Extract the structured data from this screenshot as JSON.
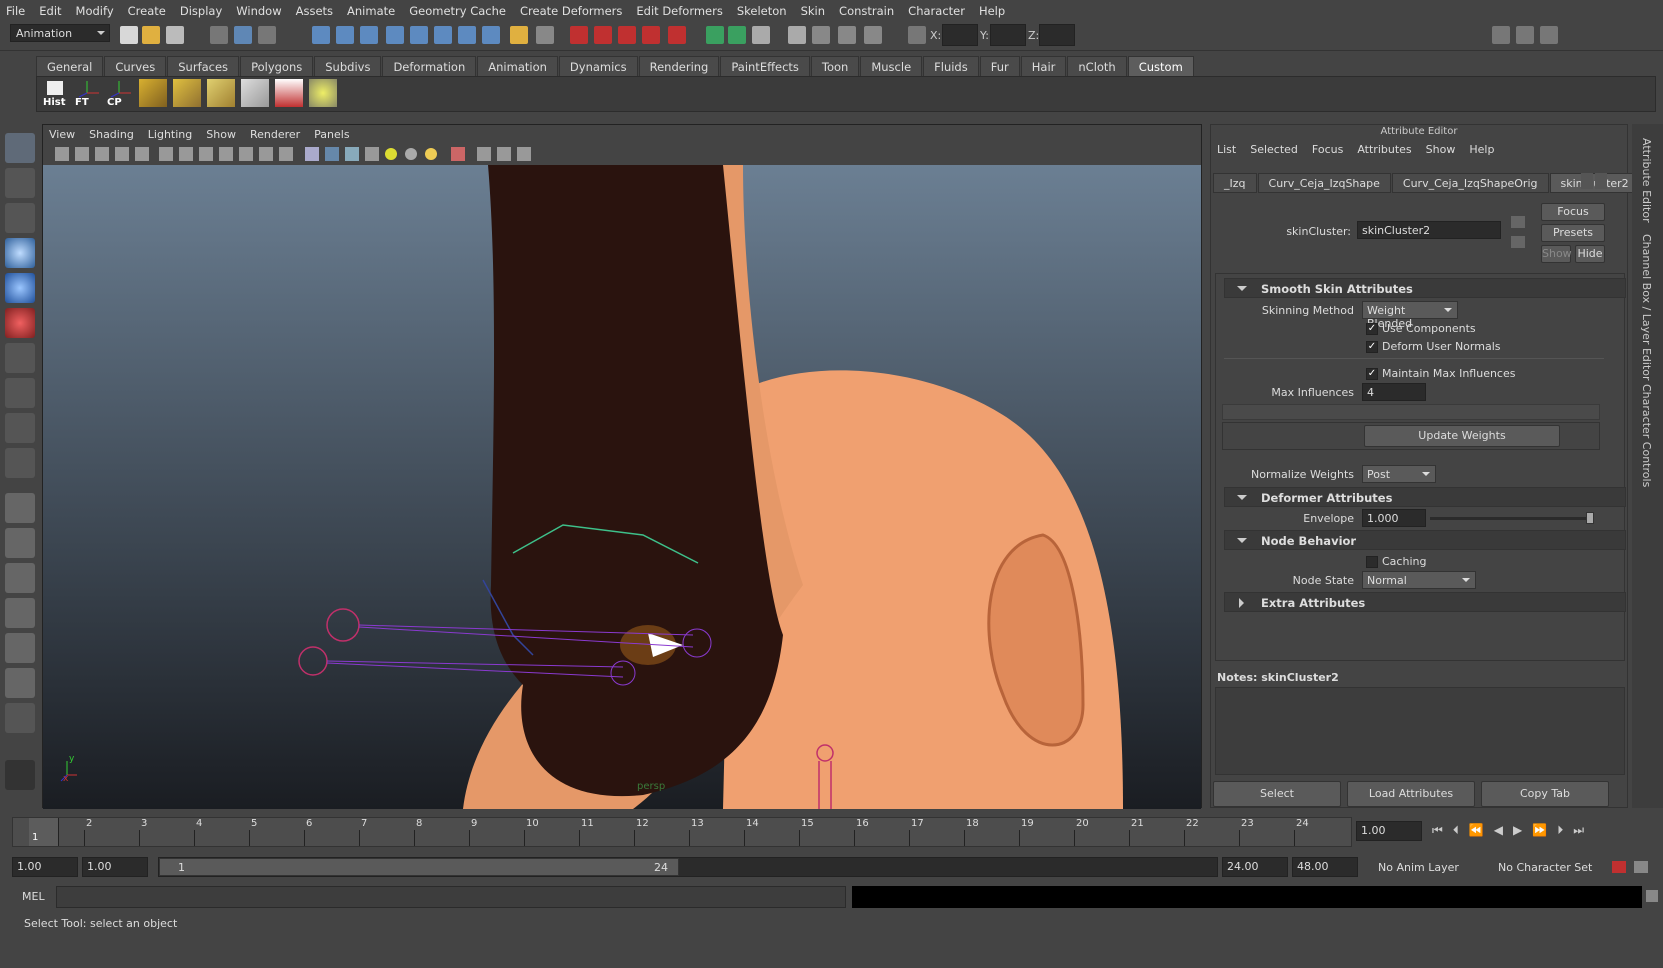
{
  "menubar": [
    "File",
    "Edit",
    "Modify",
    "Create",
    "Display",
    "Window",
    "Assets",
    "Animate",
    "Geometry Cache",
    "Create Deformers",
    "Edit Deformers",
    "Skeleton",
    "Skin",
    "Constrain",
    "Character",
    "Help"
  ],
  "status": {
    "mode": "Animation",
    "x_label": "X:",
    "y_label": "Y:",
    "z_label": "Z:"
  },
  "shelf": {
    "tabs": [
      "General",
      "Curves",
      "Surfaces",
      "Polygons",
      "Subdivs",
      "Deformation",
      "Animation",
      "Dynamics",
      "Rendering",
      "PaintEffects",
      "Toon",
      "Muscle",
      "Fluids",
      "Fur",
      "Hair",
      "nCloth",
      "Custom"
    ],
    "active_tab": "Custom",
    "buttons": [
      "Hist",
      "FT",
      "CP"
    ]
  },
  "viewport": {
    "menu": [
      "View",
      "Shading",
      "Lighting",
      "Show",
      "Renderer",
      "Panels"
    ],
    "camera_label": "persp",
    "axis_x": "x",
    "axis_y": "y"
  },
  "attribute_editor": {
    "title": "Attribute Editor",
    "menu": [
      "List",
      "Selected",
      "Focus",
      "Attributes",
      "Show",
      "Help"
    ],
    "tabs": [
      "_Izq",
      "Curv_Ceja_IzqShape",
      "Curv_Ceja_IzqShapeOrig",
      "skinCluster2"
    ],
    "active_tab": "skinCluster2",
    "node_label": "skinCluster:",
    "node_value": "skinCluster2",
    "focus_btn": "Focus",
    "presets_btn": "Presets",
    "show_btn": "Show",
    "hide_btn": "Hide",
    "smooth": {
      "header": "Smooth Skin Attributes",
      "skinning_method_label": "Skinning Method",
      "skinning_method": "Weight Blended",
      "use_components": "Use Components",
      "deform_user_normals": "Deform User Normals",
      "maintain_max": "Maintain Max Influences",
      "max_influences_label": "Max Influences",
      "max_influences": "4",
      "update_weights": "Update Weights",
      "normalize_label": "Normalize Weights",
      "normalize": "Post"
    },
    "deformer": {
      "header": "Deformer Attributes",
      "envelope_label": "Envelope",
      "envelope": "1.000",
      "envelope_fraction": 1.0
    },
    "node_behavior": {
      "header": "Node Behavior",
      "caching": "Caching",
      "node_state_label": "Node State",
      "node_state": "Normal"
    },
    "extra": {
      "header": "Extra Attributes"
    },
    "notes_label": "Notes:  skinCluster2",
    "select_btn": "Select",
    "load_btn": "Load Attributes",
    "copy_btn": "Copy Tab",
    "side_tabs": [
      "Attribute Editor",
      "Channel Box / Layer Editor",
      "Character Controls"
    ]
  },
  "timeline": {
    "frames": [
      "1",
      "2",
      "3",
      "4",
      "5",
      "6",
      "7",
      "8",
      "9",
      "10",
      "11",
      "12",
      "13",
      "14",
      "15",
      "16",
      "17",
      "18",
      "19",
      "20",
      "21",
      "22",
      "23",
      "24"
    ],
    "current_frame": "1",
    "current_field": "1.00"
  },
  "range": {
    "start": "1.00",
    "start2": "1.00",
    "slider_start": "1",
    "slider_end": "24",
    "end": "24.00",
    "end2": "48.00",
    "anim_layer": "No Anim Layer",
    "char_set": "No Character Set"
  },
  "cmd": {
    "label": "MEL"
  },
  "help": "Select Tool: select an object"
}
